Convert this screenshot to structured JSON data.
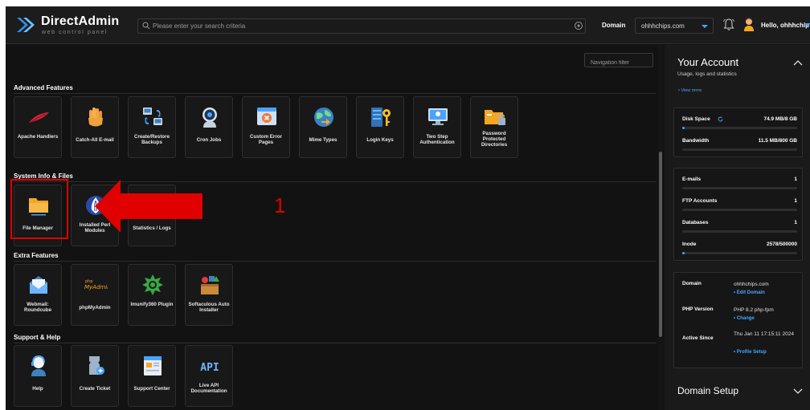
{
  "app": {
    "title": "DirectAdmin",
    "subtitle": "web control panel"
  },
  "header": {
    "search_placeholder": "Please enter your search criteria",
    "domain_label": "Domain",
    "domain_value": "ohhhchips.com",
    "greeting": "Hello, ohhhchip"
  },
  "nav_filter_placeholder": "Navigation filter",
  "sections": {
    "advanced": {
      "title": "Advanced Features",
      "items": [
        {
          "label": "Apache Handlers",
          "icon": "feather-icon"
        },
        {
          "label": "Catch-All E-mail",
          "icon": "hand-icon"
        },
        {
          "label": "Create/Restore Backups",
          "icon": "backup-icon"
        },
        {
          "label": "Cron Jobs",
          "icon": "cron-robot-icon"
        },
        {
          "label": "Custom Error Pages",
          "icon": "error-page-icon"
        },
        {
          "label": "Mime Types",
          "icon": "mime-types-icon"
        },
        {
          "label": "Login Keys",
          "icon": "key-icon"
        },
        {
          "label": "Two Step Authentication",
          "icon": "two-step-auth-icon"
        },
        {
          "label": "Password Protected Directories",
          "icon": "locked-folder-icon"
        }
      ]
    },
    "system": {
      "title": "System Info & Files",
      "items": [
        {
          "label": "File Manager",
          "icon": "folder-icon"
        },
        {
          "label": "Installed Perl Modules",
          "icon": "perl-icon"
        },
        {
          "label": "Statistics / Logs",
          "icon": "statistics-icon"
        }
      ]
    },
    "extra": {
      "title": "Extra Features",
      "items": [
        {
          "label": "Webmail: Roundcube",
          "icon": "webmail-icon"
        },
        {
          "label": "phpMyAdmin",
          "icon": "phpmyadmin-icon"
        },
        {
          "label": "Imunify360 Plugin",
          "icon": "imunify-icon"
        },
        {
          "label": "Softaculous Auto Installer",
          "icon": "softaculous-icon"
        }
      ]
    },
    "support": {
      "title": "Support & Help",
      "items": [
        {
          "label": "Help",
          "icon": "help-agent-icon"
        },
        {
          "label": "Create Ticket",
          "icon": "ticket-icon"
        },
        {
          "label": "Support Center",
          "icon": "support-center-icon"
        },
        {
          "label": "Live API Documentation",
          "icon": "api-icon"
        }
      ]
    }
  },
  "phpmyadmin_logo_text": "MyAdmin",
  "api_icon_text": "API",
  "account": {
    "title": "Your Account",
    "subtitle": "Usage, logs and statistics",
    "view_more": "• View more",
    "disk": {
      "label": "Disk Space",
      "value": "74.9 MB/8 GB",
      "fraction": 0.01
    },
    "bandwidth": {
      "label": "Bandwidth",
      "value": "11.5 MB/800 GB",
      "fraction": 0.0
    },
    "emails": {
      "label": "E-mails",
      "value": "1"
    },
    "ftp": {
      "label": "FTP Accounts",
      "value": "1"
    },
    "databases": {
      "label": "Databases",
      "value": "1"
    },
    "inode": {
      "label": "Inode",
      "value": "2578/500000",
      "fraction": 0.01
    },
    "info": {
      "domain_label": "Domain",
      "domain_value": "ohhhchips.com",
      "edit_domain": "• Edit Domain",
      "php_label": "PHP Version",
      "php_value": "PHP 8.2 php-fpm",
      "change": "• Change",
      "active_label": "Active Since",
      "active_value": "Thu Jan 11 17:15:11 2024",
      "profile_setup": "• Profile Setup"
    },
    "domain_setup": "Domain Setup"
  },
  "annotation": {
    "number": "1"
  },
  "colors": {
    "accent": "#4aa3ff",
    "annotation": "#e00000",
    "background": "#121212"
  }
}
